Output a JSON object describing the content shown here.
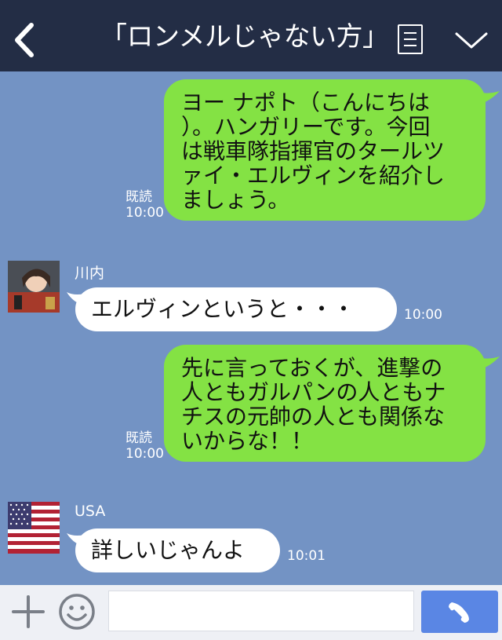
{
  "header": {
    "title": "「ロンメルじゃない方」"
  },
  "messages": [
    {
      "text_lines": [
        "ヨー ナポト（こんにちは",
        "）。ハンガリーです。今回",
        "は戦車隊指揮官のタールツ",
        "ァイ・エルヴィンを紹介し",
        "ましょう。"
      ],
      "read": "既読",
      "time": "10:00"
    },
    {
      "sender": "川内",
      "text": "エルヴィンというと・・・",
      "time": "10:00"
    },
    {
      "text_lines": [
        "先に言っておくが、進撃の",
        "人ともガルパンの人ともナ",
        "チスの元帥の人とも関係な",
        "いからな！！"
      ],
      "read": "既読",
      "time": "10:00"
    },
    {
      "sender": "USA",
      "text": "詳しいじゃんよ",
      "time": "10:01"
    }
  ],
  "footer": {
    "input_value": ""
  },
  "colors": {
    "header_bg": "#232d45",
    "chat_bg": "#7393c4",
    "outgoing_bubble": "#84e244",
    "incoming_bubble": "#ffffff",
    "call_button": "#5a86e4"
  }
}
